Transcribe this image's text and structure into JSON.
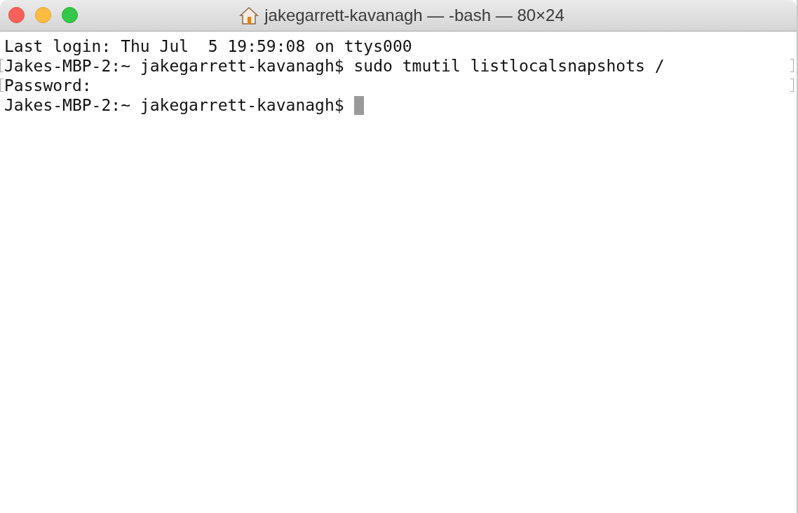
{
  "window": {
    "title": "jakegarrett-kavanagh — -bash — 80×24"
  },
  "lines": [
    {
      "text": "Last login: Thu Jul  5 19:59:08 on ttys000",
      "marked": false,
      "cursor": false
    },
    {
      "text": "Jakes-MBP-2:~ jakegarrett-kavanagh$ sudo tmutil listlocalsnapshots /",
      "marked": true,
      "cursor": false
    },
    {
      "text": "Password:",
      "marked": true,
      "cursor": false
    },
    {
      "text": "Jakes-MBP-2:~ jakegarrett-kavanagh$ ",
      "marked": false,
      "cursor": true
    }
  ]
}
